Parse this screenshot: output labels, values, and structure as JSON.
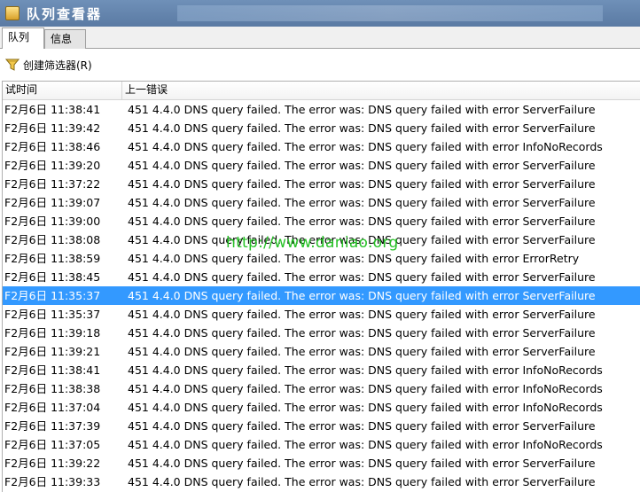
{
  "window": {
    "title": "队列查看器"
  },
  "tabs": [
    {
      "label": "队列",
      "active": true
    },
    {
      "label": "信息",
      "active": false
    }
  ],
  "toolbar": {
    "create_filter_label": "创建筛选器(R)",
    "icon": "funnel-icon"
  },
  "grid": {
    "columns": [
      "试时间",
      "上一错误"
    ],
    "selected_row_index": 10,
    "rows": [
      {
        "time": "F2月6日 11:38:41",
        "error": "451 4.4.0 DNS query failed. The error was: DNS query failed with error ServerFailure"
      },
      {
        "time": "F2月6日 11:39:42",
        "error": "451 4.4.0 DNS query failed. The error was: DNS query failed with error ServerFailure"
      },
      {
        "time": "F2月6日 11:38:46",
        "error": "451 4.4.0 DNS query failed. The error was: DNS query failed with error InfoNoRecords"
      },
      {
        "time": "F2月6日 11:39:20",
        "error": "451 4.4.0 DNS query failed. The error was: DNS query failed with error ServerFailure"
      },
      {
        "time": "F2月6日 11:37:22",
        "error": "451 4.4.0 DNS query failed. The error was: DNS query failed with error ServerFailure"
      },
      {
        "time": "F2月6日 11:39:07",
        "error": "451 4.4.0 DNS query failed. The error was: DNS query failed with error ServerFailure"
      },
      {
        "time": "F2月6日 11:39:00",
        "error": "451 4.4.0 DNS query failed. The error was: DNS query failed with error ServerFailure"
      },
      {
        "time": "F2月6日 11:38:08",
        "error": "451 4.4.0 DNS query failed. The error was: DNS query failed with error ServerFailure"
      },
      {
        "time": "F2月6日 11:38:59",
        "error": "451 4.4.0 DNS query failed. The error was: DNS query failed with error ErrorRetry"
      },
      {
        "time": "F2月6日 11:38:45",
        "error": "451 4.4.0 DNS query failed. The error was: DNS query failed with error ServerFailure"
      },
      {
        "time": "F2月6日 11:35:37",
        "error": "451 4.4.0 DNS query failed. The error was: DNS query failed with error ServerFailure"
      },
      {
        "time": "F2月6日 11:35:37",
        "error": "451 4.4.0 DNS query failed. The error was: DNS query failed with error ServerFailure"
      },
      {
        "time": "F2月6日 11:39:18",
        "error": "451 4.4.0 DNS query failed. The error was: DNS query failed with error ServerFailure"
      },
      {
        "time": "F2月6日 11:39:21",
        "error": "451 4.4.0 DNS query failed. The error was: DNS query failed with error ServerFailure"
      },
      {
        "time": "F2月6日 11:38:41",
        "error": "451 4.4.0 DNS query failed. The error was: DNS query failed with error InfoNoRecords"
      },
      {
        "time": "F2月6日 11:38:38",
        "error": "451 4.4.0 DNS query failed. The error was: DNS query failed with error InfoNoRecords"
      },
      {
        "time": "F2月6日 11:37:04",
        "error": "451 4.4.0 DNS query failed. The error was: DNS query failed with error InfoNoRecords"
      },
      {
        "time": "F2月6日 11:37:39",
        "error": "451 4.4.0 DNS query failed. The error was: DNS query failed with error ServerFailure"
      },
      {
        "time": "F2月6日 11:37:05",
        "error": "451 4.4.0 DNS query failed. The error was: DNS query failed with error InfoNoRecords"
      },
      {
        "time": "F2月6日 11:39:22",
        "error": "451 4.4.0 DNS query failed. The error was: DNS query failed with error ServerFailure"
      },
      {
        "time": "F2月6日 11:39:33",
        "error": "451 4.4.0 DNS query failed. The error was: DNS query failed with error ServerFailure"
      }
    ]
  },
  "watermark": {
    "text": "http://www.daniao.org",
    "color": "#27c227"
  },
  "colors": {
    "selection": "#3399ff",
    "titlebar": "#5a7aa3"
  }
}
